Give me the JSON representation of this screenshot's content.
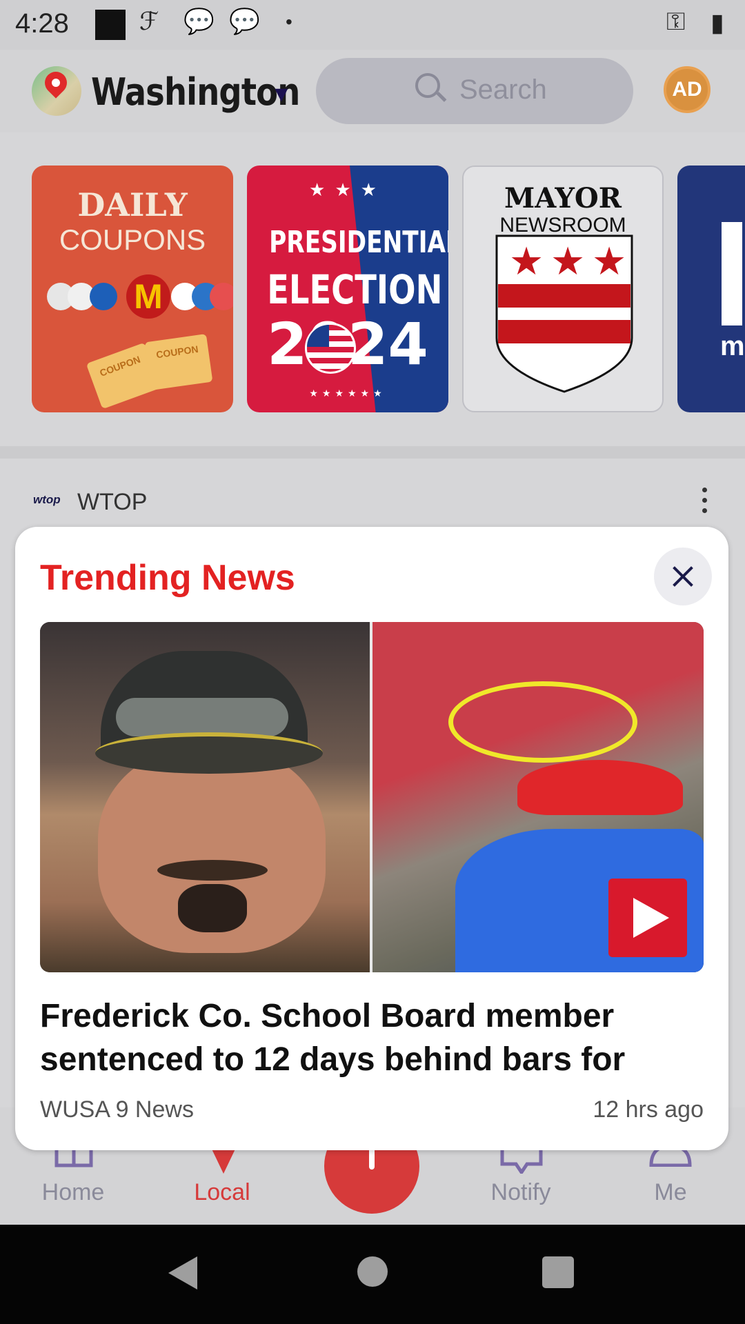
{
  "status_bar": {
    "time": "4:28"
  },
  "header": {
    "location": "Washington",
    "search_placeholder": "Search"
  },
  "channels": [
    {
      "line1": "DAILY",
      "line2": "COUPONS",
      "coupon_label": "COUPON"
    },
    {
      "line1": "PRESIDENTIAL",
      "line2": "ELECTION",
      "year": "2024"
    },
    {
      "line1": "MAYOR",
      "line2": "NEWSROOM"
    },
    {
      "line1": "m"
    }
  ],
  "feed": {
    "source_logo": "wtop",
    "source_name": "WTOP"
  },
  "modal": {
    "title": "Trending News",
    "headline": "Frederick Co. School Board member sentenced to 12 days behind bars for",
    "source": "WUSA 9 News",
    "time_ago": "12 hrs ago"
  },
  "bottom_nav": {
    "items": [
      {
        "label": "Home"
      },
      {
        "label": "Local"
      },
      {
        "label": "Notify"
      },
      {
        "label": "Me"
      }
    ]
  },
  "colors": {
    "accent": "#e32222",
    "nav_active": "#d63a3a",
    "nav_inactive": "#8a8a9a"
  }
}
